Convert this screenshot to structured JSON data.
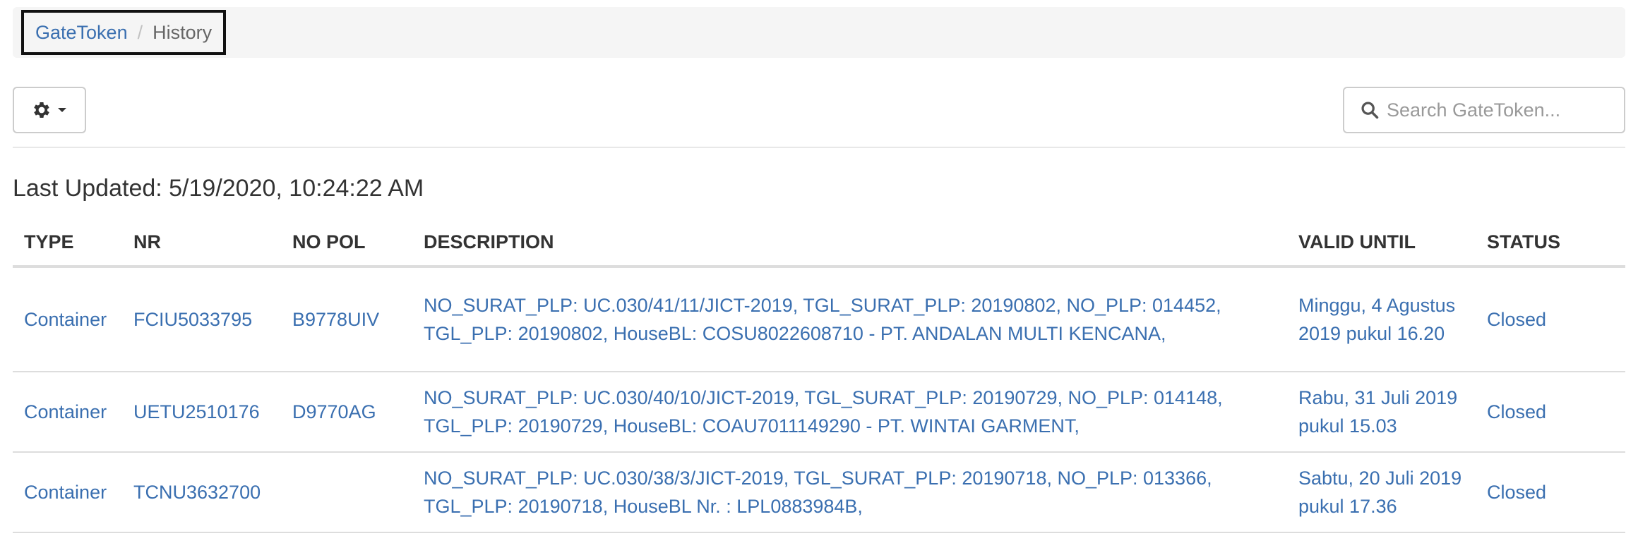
{
  "breadcrumb": {
    "items": [
      {
        "label": "GateToken"
      },
      {
        "label": "History"
      }
    ],
    "separator": "/"
  },
  "toolbar": {
    "settings_icon": "gear-icon",
    "dropdown_icon": "caret-down-icon"
  },
  "search": {
    "placeholder": "Search GateToken...",
    "value": "",
    "icon": "search-icon"
  },
  "last_updated": "Last Updated: 5/19/2020, 10:24:22 AM",
  "table": {
    "columns": [
      "TYPE",
      "NR",
      "NO POL",
      "DESCRIPTION",
      "VALID UNTIL",
      "STATUS"
    ],
    "rows": [
      {
        "type": "Container",
        "nr": "FCIU5033795",
        "no_pol": "B9778UIV",
        "description": "NO_SURAT_PLP: UC.030/41/11/JICT-2019, TGL_SURAT_PLP: 20190802, NO_PLP: 014452, TGL_PLP: 20190802, HouseBL: COSU8022608710 - PT. ANDALAN MULTI KENCANA,",
        "valid_until": "Minggu, 4 Agustus 2019 pukul 16.20",
        "status": "Closed"
      },
      {
        "type": "Container",
        "nr": "UETU2510176",
        "no_pol": "D9770AG",
        "description": "NO_SURAT_PLP: UC.030/40/10/JICT-2019, TGL_SURAT_PLP: 20190729, NO_PLP: 014148, TGL_PLP: 20190729, HouseBL: COAU7011149290 - PT. WINTAI GARMENT,",
        "valid_until": "Rabu, 31 Juli 2019 pukul 15.03",
        "status": "Closed"
      },
      {
        "type": "Container",
        "nr": "TCNU3632700",
        "no_pol": "",
        "description": "NO_SURAT_PLP: UC.030/38/3/JICT-2019, TGL_SURAT_PLP: 20190718, NO_PLP: 013366, TGL_PLP: 20190718, HouseBL Nr. : LPL0883984B,",
        "valid_until": "Sabtu, 20 Juli 2019 pukul 17.36",
        "status": "Closed"
      }
    ]
  },
  "colors": {
    "link": "#3a6fb0",
    "text": "#333333",
    "breadcrumb_bg": "#f5f5f5",
    "border": "#dddddd",
    "breadcrumb_focus_outline": "#111111"
  }
}
